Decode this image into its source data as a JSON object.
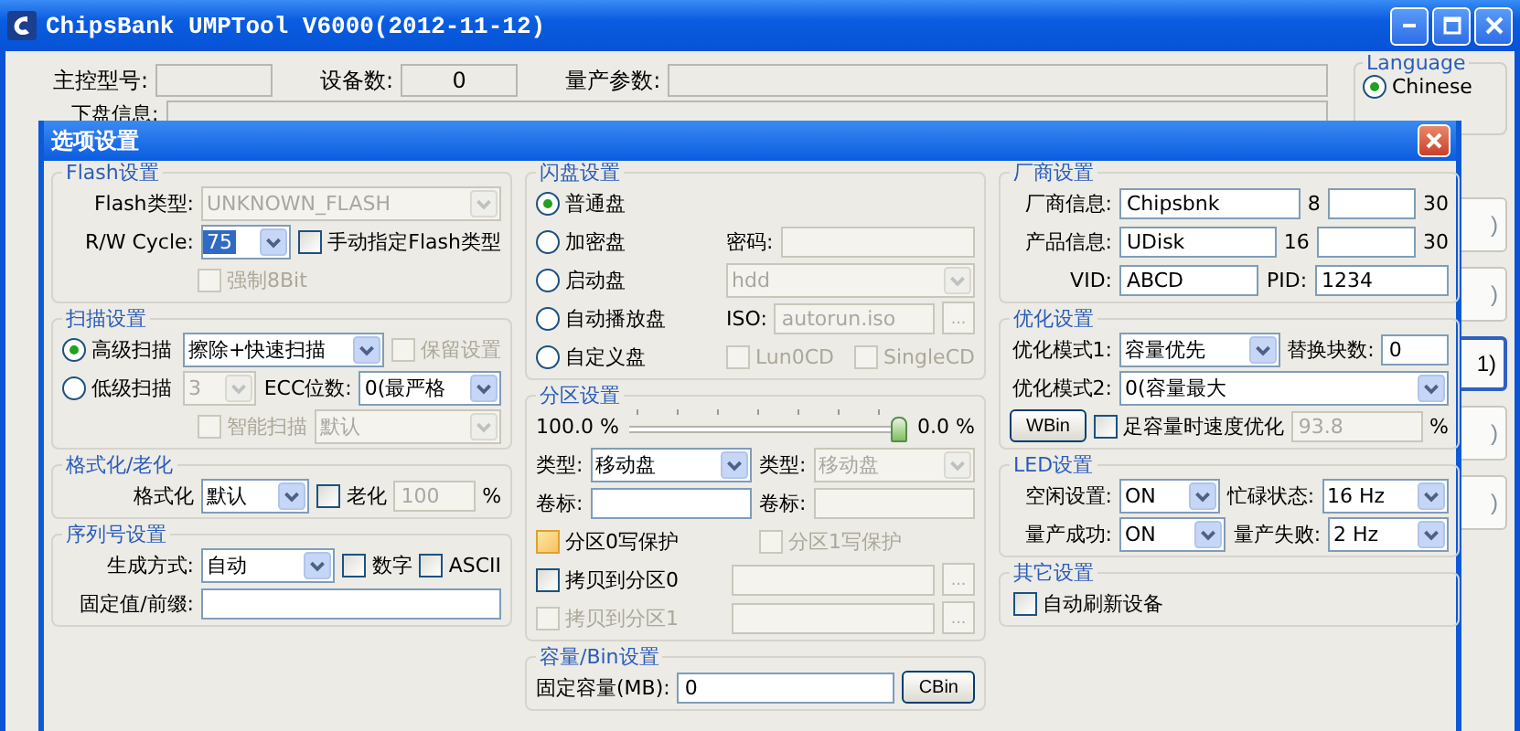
{
  "window": {
    "title": "ChipsBank UMPTool V6000(2012-11-12)"
  },
  "main": {
    "fields": [
      {
        "label": "主控型号:"
      },
      {
        "label": "设备数:",
        "value": "0"
      },
      {
        "label": "量产参数:"
      }
    ],
    "disk_info_label": "下盘信息:",
    "language": {
      "title": "Language",
      "options": [
        {
          "label": "Chinese",
          "selected": true
        }
      ]
    },
    "side_buttons": [
      {
        "text": ")",
        "focused": false
      },
      {
        "text": ")",
        "focused": false
      },
      {
        "text": "1)",
        "focused": true
      },
      {
        "text": ")",
        "focused": false
      },
      {
        "text": ")",
        "focused": false
      }
    ]
  },
  "dialog": {
    "title": "选项设置",
    "columns": [
      {
        "groups": [
          {
            "title": "Flash设置",
            "rows": [
              {
                "items": [
                  {
                    "kind": "label",
                    "text": "Flash类型:"
                  },
                  {
                    "kind": "select",
                    "value": "UNKNOWN_FLASH",
                    "disabled": true
                  }
                ]
              },
              {
                "items": [
                  {
                    "kind": "label",
                    "text": "R/W Cycle:"
                  },
                  {
                    "kind": "select",
                    "value": "75",
                    "disabled": false,
                    "highlighted": true
                  },
                  {
                    "kind": "check",
                    "text": "手动指定Flash类型",
                    "checked": false,
                    "disabled": false
                  }
                ]
              },
              {
                "items": [
                  {
                    "kind": "check",
                    "text": "强制8Bit",
                    "checked": false,
                    "disabled": true
                  }
                ]
              }
            ]
          },
          {
            "title": "扫描设置",
            "rows": [
              {
                "items": [
                  {
                    "kind": "radio",
                    "text": "高级扫描",
                    "selected": true
                  },
                  {
                    "kind": "select",
                    "value": "擦除+快速扫描",
                    "disabled": false
                  },
                  {
                    "kind": "check",
                    "text": "保留设置",
                    "checked": false,
                    "disabled": true
                  }
                ]
              },
              {
                "items": [
                  {
                    "kind": "radio",
                    "text": "低级扫描",
                    "selected": false
                  },
                  {
                    "kind": "select",
                    "value": "3",
                    "disabled": true
                  },
                  {
                    "kind": "label",
                    "text": "ECC位数:"
                  },
                  {
                    "kind": "select",
                    "value": "0(最严格",
                    "disabled": false
                  }
                ]
              },
              {
                "items": [
                  {
                    "kind": "check",
                    "text": "智能扫描",
                    "checked": false,
                    "disabled": true
                  },
                  {
                    "kind": "select",
                    "value": "默认",
                    "disabled": true
                  }
                ]
              }
            ]
          },
          {
            "title": "格式化/老化",
            "rows": [
              {
                "items": [
                  {
                    "kind": "label",
                    "text": "格式化"
                  },
                  {
                    "kind": "select",
                    "value": "默认",
                    "disabled": false
                  },
                  {
                    "kind": "check",
                    "text": "老化",
                    "checked": false,
                    "disabled": false
                  },
                  {
                    "kind": "input",
                    "value": "100",
                    "disabled": true
                  },
                  {
                    "kind": "label",
                    "text": "%"
                  }
                ]
              }
            ]
          },
          {
            "title": "序列号设置",
            "rows": [
              {
                "items": [
                  {
                    "kind": "label",
                    "text": "生成方式:"
                  },
                  {
                    "kind": "select",
                    "value": "自动",
                    "disabled": false
                  },
                  {
                    "kind": "check",
                    "text": "数字",
                    "checked": false,
                    "disabled": false
                  },
                  {
                    "kind": "check",
                    "text": "ASCII",
                    "checked": false,
                    "disabled": false
                  }
                ]
              },
              {
                "items": [
                  {
                    "kind": "label",
                    "text": "固定值/前缀:"
                  },
                  {
                    "kind": "input",
                    "disabled": false
                  }
                ]
              }
            ]
          }
        ]
      },
      {
        "groups": [
          {
            "title": "闪盘设置",
            "rows": [
              {
                "items": [
                  {
                    "kind": "radio",
                    "text": "普通盘",
                    "selected": true
                  }
                ]
              },
              {
                "items": [
                  {
                    "kind": "radio",
                    "text": "加密盘",
                    "selected": false
                  },
                  {
                    "kind": "label",
                    "text": "密码:"
                  },
                  {
                    "kind": "input",
                    "disabled": true
                  }
                ]
              },
              {
                "items": [
                  {
                    "kind": "radio",
                    "text": "启动盘",
                    "selected": false
                  },
                  {
                    "kind": "select",
                    "value": "hdd",
                    "disabled": true
                  }
                ]
              },
              {
                "items": [
                  {
                    "kind": "radio",
                    "text": "自动播放盘",
                    "selected": false
                  },
                  {
                    "kind": "label",
                    "text": "ISO:"
                  },
                  {
                    "kind": "input",
                    "value": "autorun.iso",
                    "disabled": true
                  },
                  {
                    "kind": "browse",
                    "text": "...",
                    "disabled": true
                  }
                ]
              },
              {
                "items": [
                  {
                    "kind": "radio",
                    "text": "自定义盘",
                    "selected": false
                  },
                  {
                    "kind": "check",
                    "text": "Lun0CD",
                    "checked": false,
                    "disabled": true
                  },
                  {
                    "kind": "check",
                    "text": "SingleCD",
                    "checked": false,
                    "disabled": true
                  }
                ]
              }
            ]
          },
          {
            "title": "分区设置",
            "rows": [
              {
                "items": [
                  {
                    "kind": "label",
                    "text": "100.0 %"
                  },
                  {
                    "kind": "slider",
                    "level": 1
                  },
                  {
                    "kind": "label",
                    "text": "0.0 %"
                  }
                ]
              },
              {
                "items": [
                  {
                    "kind": "label",
                    "text": "类型:"
                  },
                  {
                    "kind": "select",
                    "value": "移动盘",
                    "disabled": false
                  },
                  {
                    "kind": "label",
                    "text": "类型:"
                  },
                  {
                    "kind": "select",
                    "value": "移动盘",
                    "disabled": true
                  }
                ]
              },
              {
                "items": [
                  {
                    "kind": "label",
                    "text": "卷标:"
                  },
                  {
                    "kind": "input",
                    "disabled": false
                  },
                  {
                    "kind": "label",
                    "text": "卷标:"
                  },
                  {
                    "kind": "input",
                    "disabled": true
                  }
                ]
              },
              {
                "items": [
                  {
                    "kind": "check",
                    "text": "分区0写保护",
                    "checked": false,
                    "disabled": false,
                    "hot": true
                  },
                  {
                    "kind": "check",
                    "text": "分区1写保护",
                    "checked": false,
                    "disabled": true
                  }
                ]
              },
              {
                "items": [
                  {
                    "kind": "check",
                    "text": "拷贝到分区0",
                    "checked": false,
                    "disabled": false
                  },
                  {
                    "kind": "input",
                    "disabled": true
                  },
                  {
                    "kind": "browse",
                    "text": "...",
                    "disabled": true
                  }
                ]
              },
              {
                "items": [
                  {
                    "kind": "check",
                    "text": "拷贝到分区1",
                    "checked": false,
                    "disabled": true
                  },
                  {
                    "kind": "input",
                    "disabled": true
                  },
                  {
                    "kind": "browse",
                    "text": "...",
                    "disabled": true
                  }
                ]
              }
            ]
          },
          {
            "title": "容量/Bin设置",
            "rows": [
              {
                "items": [
                  {
                    "kind": "label",
                    "text": "固定容量(MB):"
                  },
                  {
                    "kind": "input",
                    "value": "0",
                    "disabled": false
                  },
                  {
                    "kind": "button",
                    "text": "CBin"
                  }
                ]
              }
            ]
          }
        ]
      },
      {
        "groups": [
          {
            "title": "厂商设置",
            "rows": [
              {
                "items": [
                  {
                    "kind": "label",
                    "text": "厂商信息:"
                  },
                  {
                    "kind": "input",
                    "value": "Chipsbnk",
                    "disabled": false
                  },
                  {
                    "kind": "label",
                    "text": "8"
                  },
                  {
                    "kind": "input",
                    "disabled": false
                  },
                  {
                    "kind": "label",
                    "text": "30"
                  }
                ]
              },
              {
                "items": [
                  {
                    "kind": "label",
                    "text": "产品信息:"
                  },
                  {
                    "kind": "input",
                    "value": "UDisk",
                    "disabled": false
                  },
                  {
                    "kind": "label",
                    "text": "16"
                  },
                  {
                    "kind": "input",
                    "disabled": false
                  },
                  {
                    "kind": "label",
                    "text": "30"
                  }
                ]
              },
              {
                "items": [
                  {
                    "kind": "label",
                    "text": "VID:"
                  },
                  {
                    "kind": "input",
                    "value": "ABCD",
                    "disabled": false
                  },
                  {
                    "kind": "label",
                    "text": "PID:"
                  },
                  {
                    "kind": "input",
                    "value": "1234",
                    "disabled": false
                  }
                ]
              }
            ]
          },
          {
            "title": "优化设置",
            "rows": [
              {
                "items": [
                  {
                    "kind": "label",
                    "text": "优化模式1:"
                  },
                  {
                    "kind": "select",
                    "value": "容量优先",
                    "disabled": false
                  },
                  {
                    "kind": "label",
                    "text": "替换块数:"
                  },
                  {
                    "kind": "input",
                    "value": "0",
                    "disabled": false
                  }
                ]
              },
              {
                "items": [
                  {
                    "kind": "label",
                    "text": "优化模式2:"
                  },
                  {
                    "kind": "select",
                    "value": "0(容量最大",
                    "disabled": false
                  }
                ]
              },
              {
                "items": [
                  {
                    "kind": "button",
                    "text": "WBin"
                  },
                  {
                    "kind": "check",
                    "text": "足容量时速度优化",
                    "checked": false,
                    "disabled": false
                  },
                  {
                    "kind": "input",
                    "value": "93.8",
                    "disabled": true
                  },
                  {
                    "kind": "label",
                    "text": "%"
                  }
                ]
              }
            ]
          },
          {
            "title": "LED设置",
            "rows": [
              {
                "items": [
                  {
                    "kind": "label",
                    "text": "空闲设置:"
                  },
                  {
                    "kind": "select",
                    "value": "ON",
                    "disabled": false
                  },
                  {
                    "kind": "label",
                    "text": "忙碌状态:"
                  },
                  {
                    "kind": "select",
                    "value": "16 Hz",
                    "disabled": false
                  }
                ]
              },
              {
                "items": [
                  {
                    "kind": "label",
                    "text": "量产成功:"
                  },
                  {
                    "kind": "select",
                    "value": "ON",
                    "disabled": false
                  },
                  {
                    "kind": "label",
                    "text": "量产失败:"
                  },
                  {
                    "kind": "select",
                    "value": "2 Hz",
                    "disabled": false
                  }
                ]
              }
            ]
          },
          {
            "title": "其它设置",
            "rows": [
              {
                "items": [
                  {
                    "kind": "check",
                    "text": "自动刷新设备",
                    "checked": false,
                    "disabled": false
                  }
                ]
              }
            ]
          }
        ]
      }
    ]
  }
}
